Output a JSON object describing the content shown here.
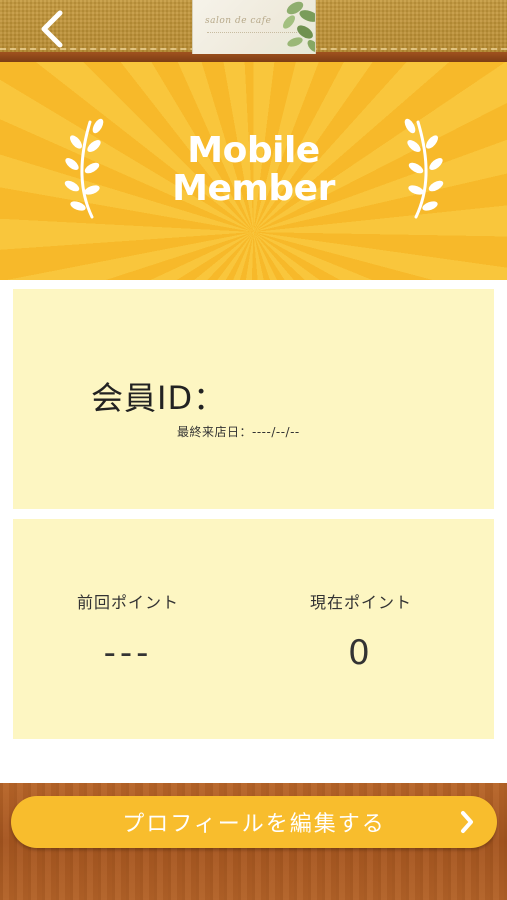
{
  "header": {
    "back_icon": "chevron-left-icon",
    "logo": {
      "name": "shop-logo",
      "script_text": "salon de cafe"
    }
  },
  "banner": {
    "title_line1": "Mobile",
    "title_line2": "Member",
    "left_icon": "laurel-branch-icon",
    "right_icon": "laurel-branch-icon"
  },
  "member": {
    "id_label": "会員ID：",
    "last_visit": "最終来店日：----/--/--"
  },
  "points": {
    "previous_label": "前回ポイント",
    "previous_value": "---",
    "current_label": "現在ポイント",
    "current_value": "0"
  },
  "footer": {
    "profile_button_label": "プロフィールを編集する",
    "profile_button_icon": "chevron-right-icon"
  },
  "colors": {
    "banner_yellow": "#f9c63c",
    "panel_cream": "#fdf6c2",
    "button_yellow": "#f8bd2d",
    "wood_brown": "#a5551f"
  }
}
